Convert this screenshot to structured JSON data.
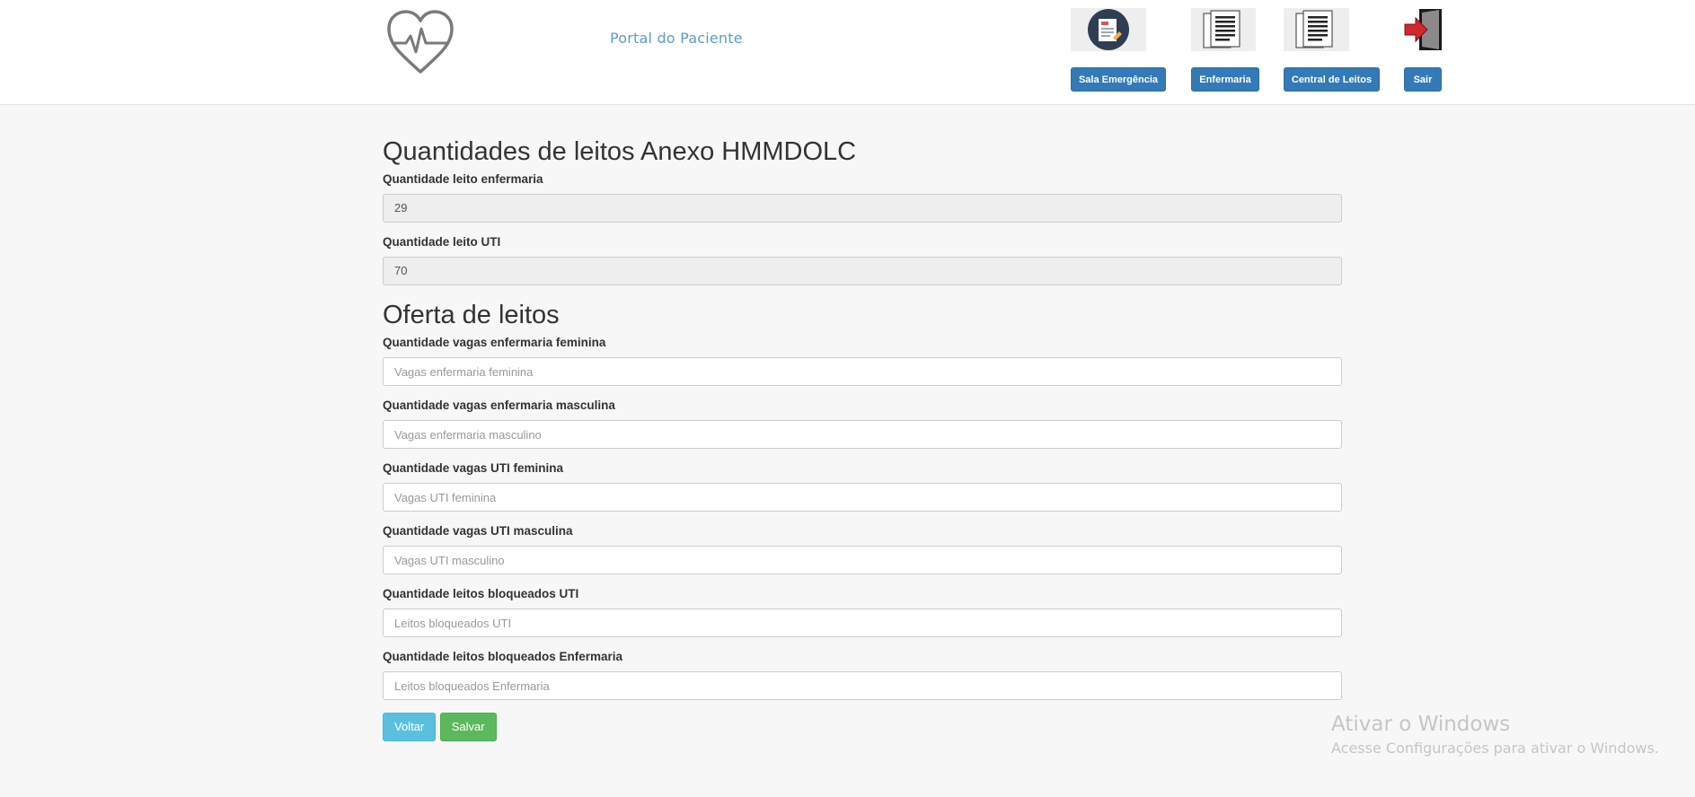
{
  "header": {
    "portal_title": "Portal do Paciente",
    "nav": [
      {
        "label": "Sala Emergência",
        "icon": "emergency-doc-icon"
      },
      {
        "label": "Enfermaria",
        "icon": "documents-icon"
      },
      {
        "label": "Central de Leitos",
        "icon": "documents-icon"
      },
      {
        "label": "Sair",
        "icon": "exit-door-icon"
      }
    ],
    "logo_icon": "heart-pulse-icon"
  },
  "section_quantities": {
    "title": "Quantidades de leitos Anexo HMMDOLC",
    "fields": [
      {
        "label": "Quantidade leito enfermaria",
        "value": "29"
      },
      {
        "label": "Quantidade leito UTI",
        "value": "70"
      }
    ]
  },
  "section_offer": {
    "title": "Oferta de leitos",
    "fields": [
      {
        "label": "Quantidade vagas enfermaria feminina",
        "placeholder": "Vagas enfermaria feminina"
      },
      {
        "label": "Quantidade vagas enfermaria masculina",
        "placeholder": "Vagas enfermaria masculino"
      },
      {
        "label": "Quantidade vagas UTI feminina",
        "placeholder": "Vagas UTI feminina"
      },
      {
        "label": "Quantidade vagas UTI masculina",
        "placeholder": "Vagas UTI masculino"
      },
      {
        "label": "Quantidade leitos bloqueados UTI",
        "placeholder": "Leitos bloqueados UTI"
      },
      {
        "label": "Quantidade leitos bloqueados Enfermaria",
        "placeholder": "Leitos bloqueados Enfermaria"
      }
    ]
  },
  "actions": {
    "back_label": "Voltar",
    "save_label": "Salvar"
  },
  "watermark": {
    "title": "Ativar o Windows",
    "subtitle": "Acesse Configurações para ativar o Windows."
  },
  "colors": {
    "primary": "#337ab7",
    "info": "#5bc0de",
    "success": "#5cb85c",
    "portal_title": "#5b9bd1"
  }
}
